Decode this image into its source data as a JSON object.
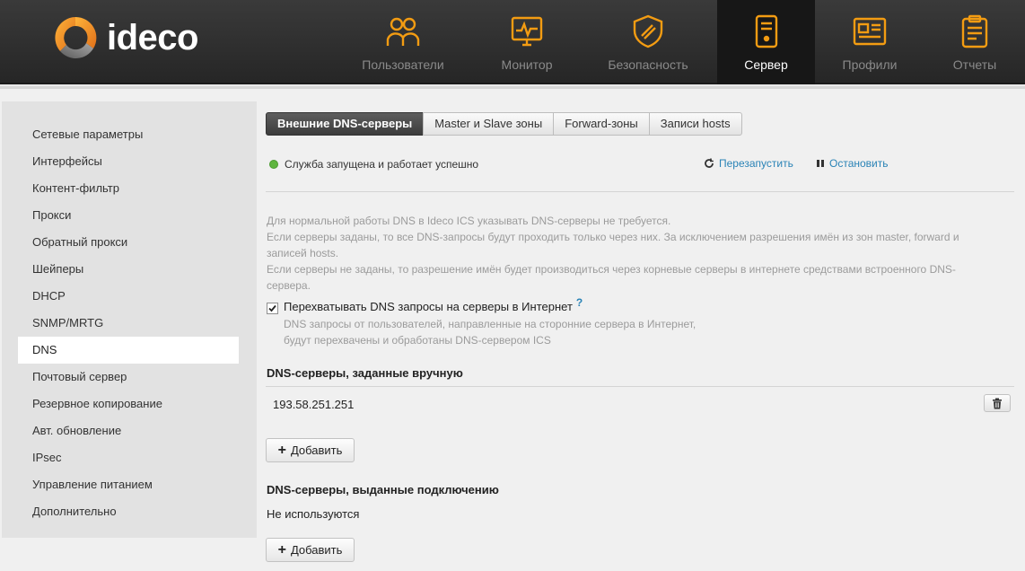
{
  "brand": {
    "name": "ideco",
    "accent": "#f39c12"
  },
  "nav": [
    {
      "label": "Пользователи",
      "icon": "users-icon"
    },
    {
      "label": "Монитор",
      "icon": "monitor-icon"
    },
    {
      "label": "Безопасность",
      "icon": "shield-icon"
    },
    {
      "label": "Сервер",
      "icon": "server-icon",
      "active": true
    },
    {
      "label": "Профили",
      "icon": "profile-card-icon"
    },
    {
      "label": "Отчеты",
      "icon": "clipboard-icon"
    }
  ],
  "sidebar": {
    "items": [
      {
        "label": "Сетевые параметры"
      },
      {
        "label": "Интерфейсы"
      },
      {
        "label": "Контент-фильтр"
      },
      {
        "label": "Прокси"
      },
      {
        "label": "Обратный прокси"
      },
      {
        "label": "Шейперы"
      },
      {
        "label": "DHCP"
      },
      {
        "label": "SNMP/MRTG"
      },
      {
        "label": "DNS",
        "active": true
      },
      {
        "label": "Почтовый сервер"
      },
      {
        "label": "Резервное копирование"
      },
      {
        "label": "Авт. обновление"
      },
      {
        "label": "IPsec"
      },
      {
        "label": "Управление питанием"
      },
      {
        "label": "Дополнительно"
      }
    ]
  },
  "tabs": [
    {
      "label": "Внешние DNS-серверы",
      "active": true
    },
    {
      "label": "Master и Slave зоны"
    },
    {
      "label": "Forward-зоны"
    },
    {
      "label": "Записи hosts"
    }
  ],
  "status": {
    "text": "Служба запущена и работает успешно",
    "color": "#5fb53f"
  },
  "actions": {
    "restart": "Перезапустить",
    "stop": "Остановить"
  },
  "info": {
    "line1": "Для нормальной работы DNS в Ideco ICS указывать DNS-серверы не требуется.",
    "line2": "Если серверы заданы, то все DNS-запросы будут проходить только через них. За исключением разрешения имён из зон master, forward и записей hosts.",
    "line3": "Если серверы не заданы, то разрешение имён будет производиться через корневые серверы в интернете средствами встроенного DNS-сервера."
  },
  "intercept": {
    "label": "Перехватывать DNS запросы на серверы в Интернет",
    "help": "?",
    "checked": true,
    "description": "DNS запросы от пользователей, направленные на сторонние сервера в Интернет, будут перехвачены и обработаны DNS-сервером ICS"
  },
  "manual": {
    "title": "DNS-серверы, заданные вручную",
    "servers": [
      "193.58.251.251"
    ],
    "add_label": "Добавить"
  },
  "connection": {
    "title": "DNS-серверы, выданные подключению",
    "empty_text": "Не используются",
    "add_label": "Добавить"
  }
}
